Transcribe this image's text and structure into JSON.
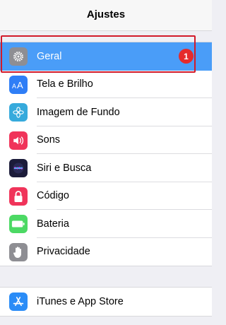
{
  "nav": {
    "title": "Ajustes"
  },
  "group1": [
    {
      "label": "Geral",
      "icon": "gear-icon",
      "color": "#8e8e93",
      "badge": "1",
      "selected": true
    },
    {
      "label": "Tela e Brilho",
      "icon": "text-size-icon",
      "color": "#2f7ef6"
    },
    {
      "label": "Imagem de Fundo",
      "icon": "flower-icon",
      "color": "#36aadc"
    },
    {
      "label": "Sons",
      "icon": "speaker-icon",
      "color": "#f0345a"
    },
    {
      "label": "Siri e Busca",
      "icon": "siri-icon",
      "color": "#1c1c3a"
    },
    {
      "label": "Código",
      "icon": "lock-icon",
      "color": "#f0345a"
    },
    {
      "label": "Bateria",
      "icon": "battery-icon",
      "color": "#4cd964"
    },
    {
      "label": "Privacidade",
      "icon": "hand-icon",
      "color": "#8e8e93"
    }
  ],
  "group2": [
    {
      "label": "iTunes e App Store",
      "icon": "app-store-icon",
      "color": "#2a8cf7"
    }
  ],
  "colors": {
    "accent": "#4a9df8",
    "badge": "#e52b2b",
    "highlight_border": "#d21a2a"
  }
}
